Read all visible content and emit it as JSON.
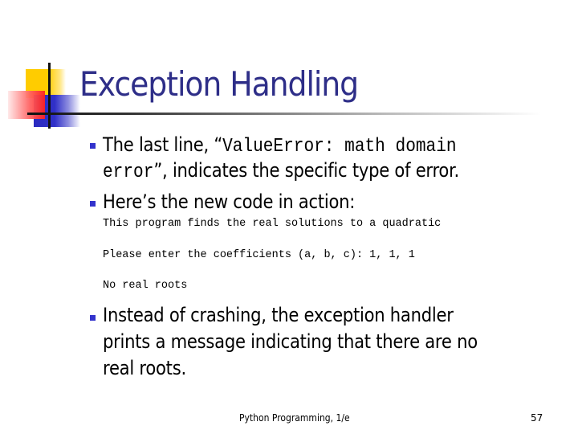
{
  "slide": {
    "title": "Exception Handling",
    "bullets": [
      {
        "prefix": "The last line, “",
        "code1": "ValueError: math domain",
        "code2": "error",
        "suffix": "”, indicates the specific type of error."
      },
      {
        "text": "Here’s the new code in action:"
      },
      {
        "line1": "Instead of crashing, the exception handler",
        "line2": "prints a message indicating that there are no",
        "line3": "real roots."
      }
    ],
    "code_output": [
      "This program finds the real solutions to a quadratic",
      "Please enter the coefficients (a, b, c): 1, 1, 1",
      "No real roots"
    ],
    "footer": {
      "text": "Python Programming, 1/e",
      "page_number": "57"
    }
  },
  "colors": {
    "title": "#2e2e88",
    "bullet": "#3333cc",
    "accent_yellow": "#ffcc00",
    "accent_red": "#ff2020",
    "accent_blue": "#2a2ac0"
  }
}
